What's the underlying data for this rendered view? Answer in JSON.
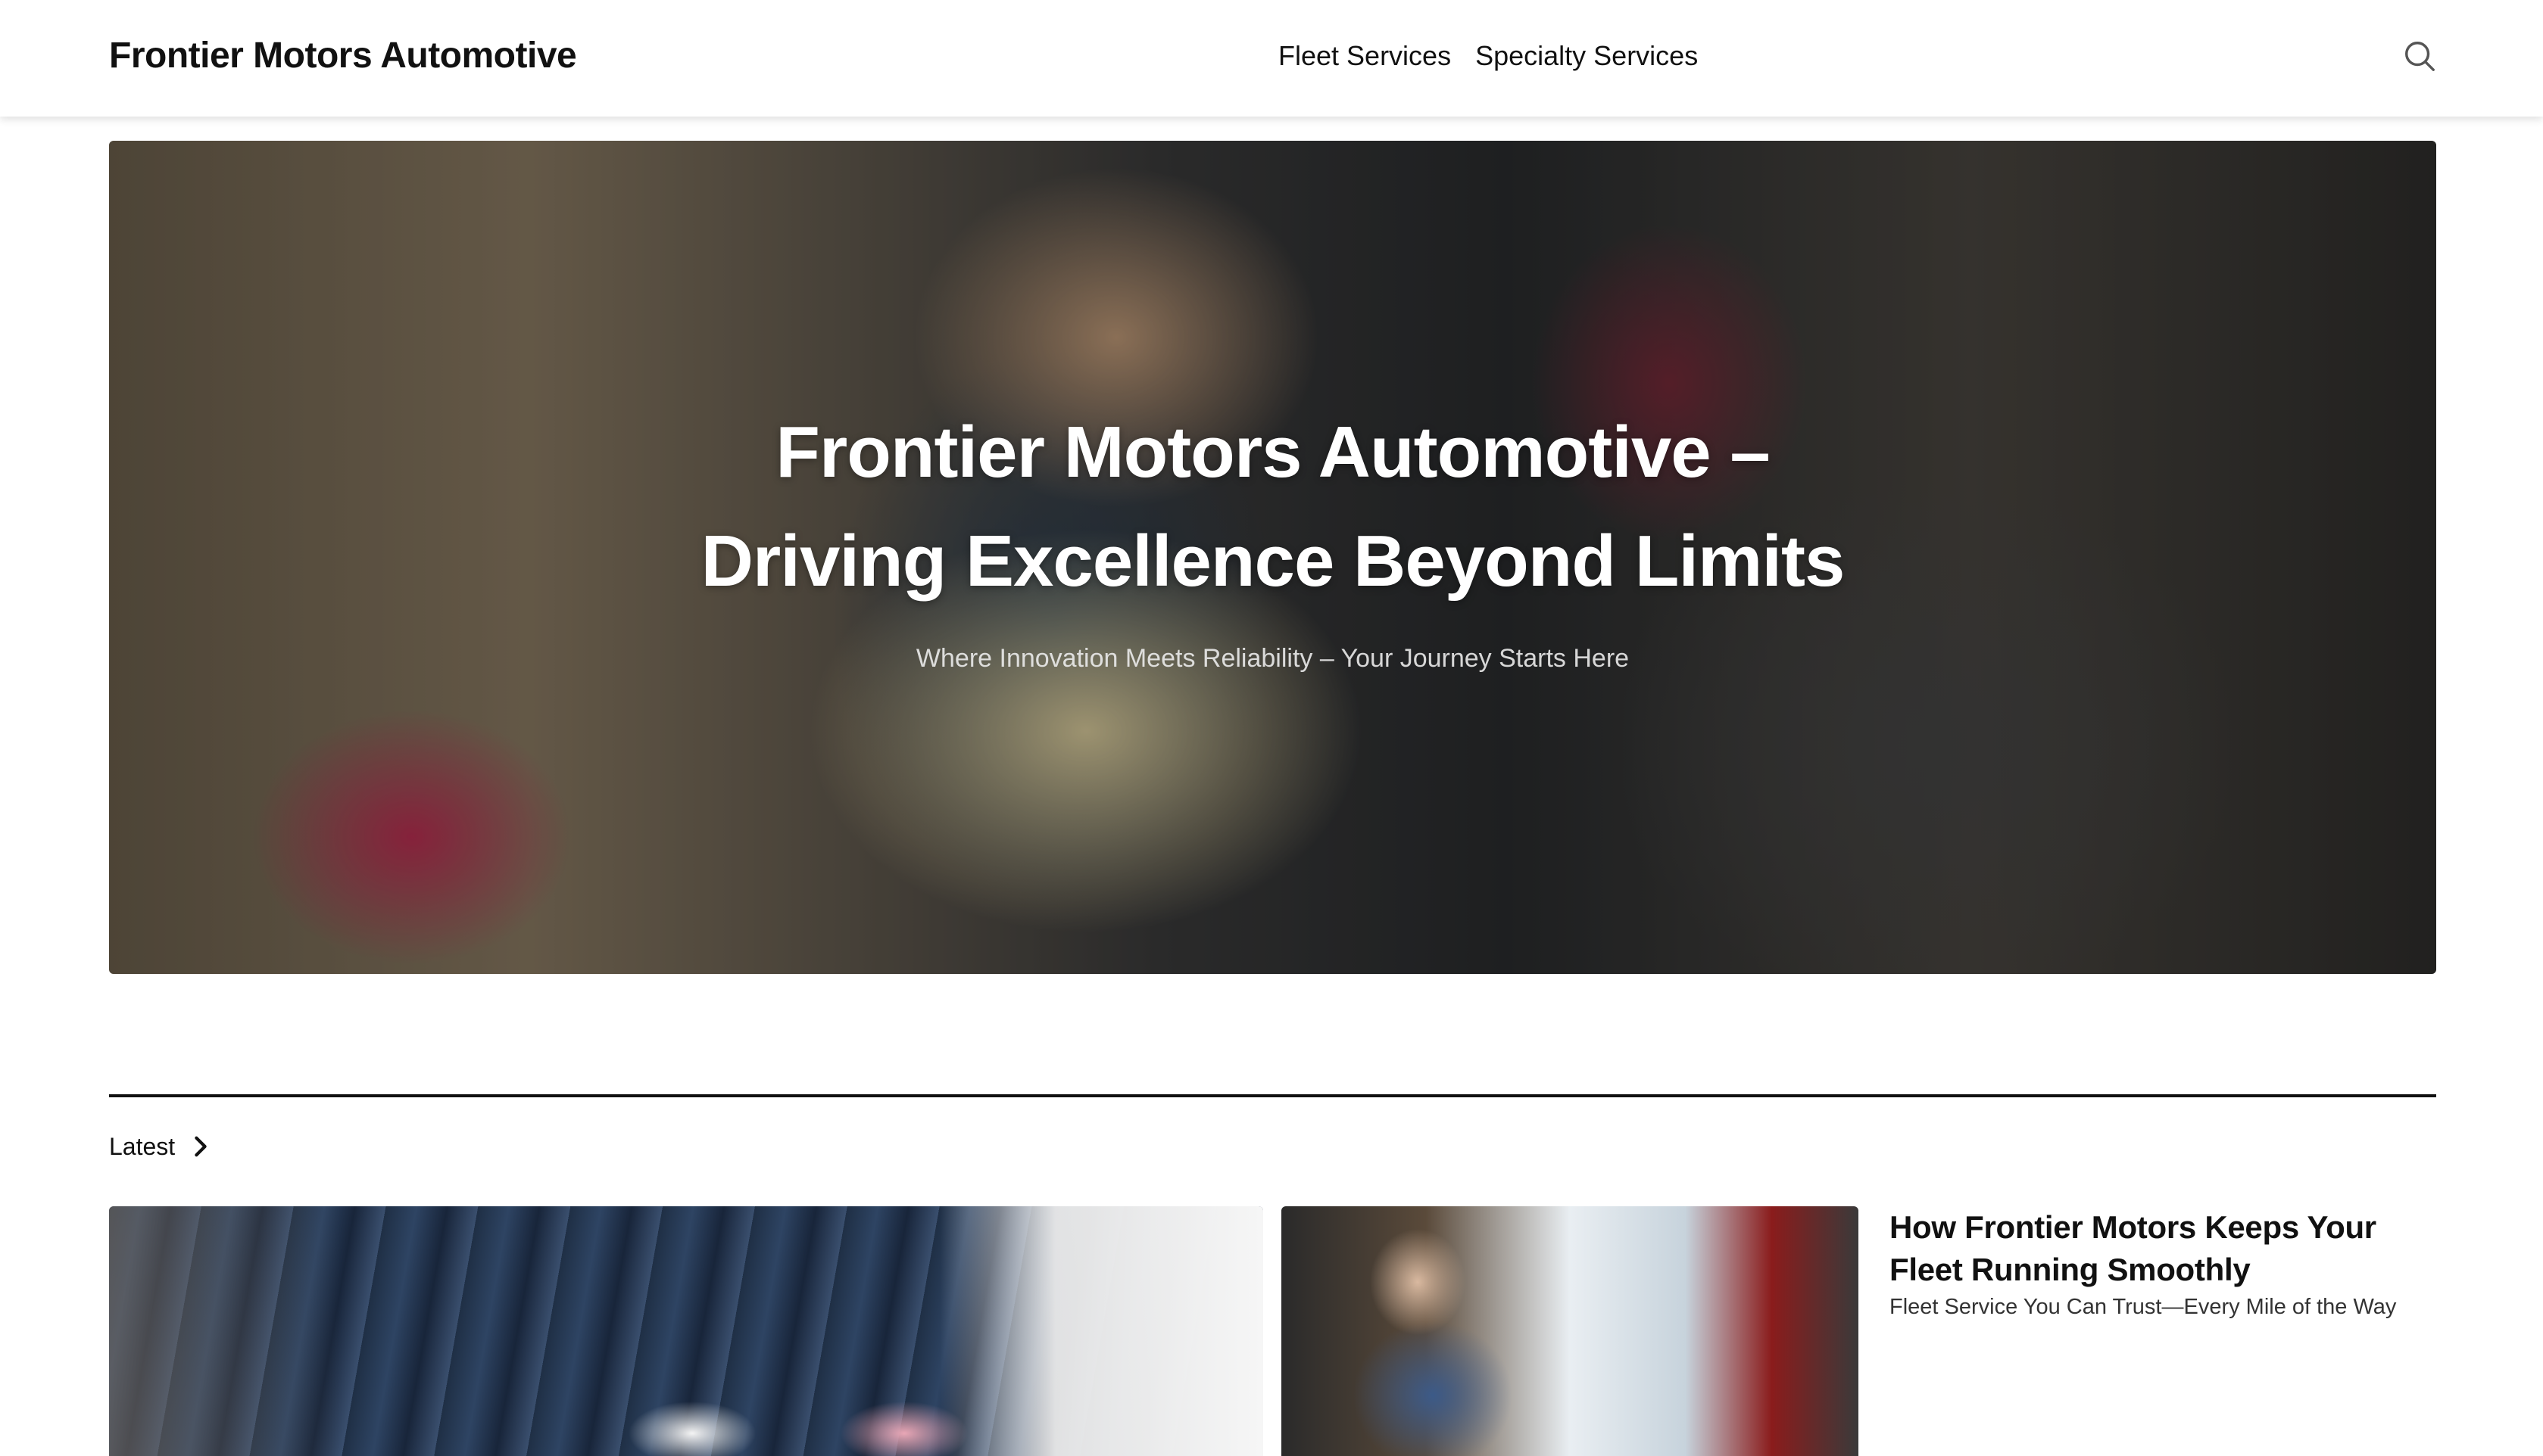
{
  "header": {
    "site_title": "Frontier Motors Automotive",
    "nav": [
      {
        "label": "Fleet Services"
      },
      {
        "label": "Specialty Services"
      }
    ],
    "search_icon": "search-icon"
  },
  "hero": {
    "title": "Frontier Motors Automotive – Driving Excellence Beyond Limits",
    "subtitle": "Where Innovation Meets Reliability – Your Journey Starts Here"
  },
  "latest": {
    "label": "Latest",
    "icon": "chevron-right-icon",
    "post": {
      "title": "How Frontier Motors Keeps Your Fleet Running Smoothly",
      "excerpt": "Fleet Service You Can Trust—Every Mile of the Way"
    }
  }
}
